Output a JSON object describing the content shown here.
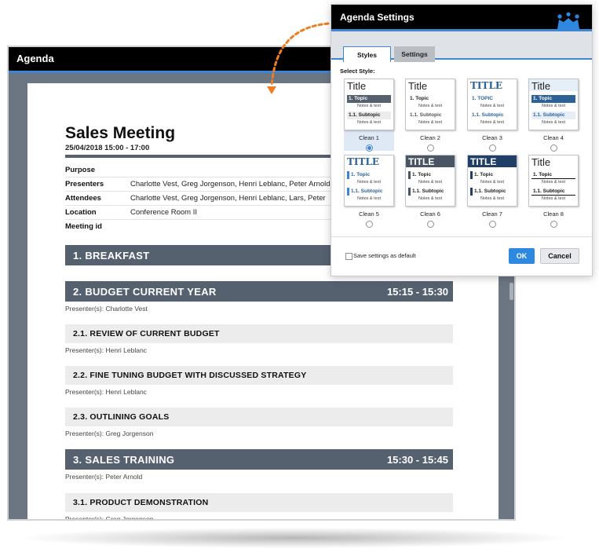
{
  "agenda": {
    "title": "Agenda",
    "meeting_title": "Sales Meeting",
    "meeting_date": "25/04/2018 15:00 - 17:00",
    "info": [
      {
        "label": "Purpose",
        "value": ""
      },
      {
        "label": "Presenters",
        "value": "Charlotte Vest, Greg Jorgenson, Henri Leblanc, Peter Arnold"
      },
      {
        "label": "Attendees",
        "value": "Charlotte Vest, Greg Jorgenson, Henri Leblanc, Lars, Peter"
      },
      {
        "label": "Location",
        "value": "Conference Room II"
      },
      {
        "label": "Meeting id",
        "value": ""
      }
    ],
    "items": [
      {
        "kind": "section",
        "title": "1. BREAKFAST",
        "time": ""
      },
      {
        "kind": "section",
        "title": "2. BUDGET CURRENT YEAR",
        "time": "15:15 - 15:30",
        "presenter": "Presenter(s): Charlotte Vest"
      },
      {
        "kind": "sub",
        "title": "2.1. REVIEW OF CURRENT BUDGET",
        "presenter": "Presenter(s): Henri Leblanc"
      },
      {
        "kind": "sub",
        "title": "2.2. FINE TUNING BUDGET WITH DISCUSSED STRATEGY",
        "presenter": "Presenter(s): Henri Leblanc"
      },
      {
        "kind": "sub",
        "title": "2.3. OUTLINING GOALS",
        "presenter": "Presenter(s): Greg Jorgenson"
      },
      {
        "kind": "section",
        "title": "3. SALES TRAINING",
        "time": "15:30 - 15:45",
        "presenter": "Presenter(s): Peter Arnold"
      },
      {
        "kind": "sub",
        "title": "3.1. PRODUCT DEMONSTRATION",
        "presenter": "Presenter(s): Greg Jorgenson"
      }
    ]
  },
  "settings_dialog": {
    "title": "Agenda Settings",
    "logo_icon": "people-group-icon",
    "tabs": [
      {
        "label": "Styles",
        "active": true
      },
      {
        "label": "Settings",
        "active": false
      }
    ],
    "select_label": "Select Style:",
    "styles": [
      {
        "label": "Clean 1",
        "selected": true,
        "thumb": {
          "title": "Title",
          "topic": "1. Topic",
          "notes1": "Notes & text",
          "subtopic": "1.1. Subtopic",
          "notes2": "Notes & text"
        }
      },
      {
        "label": "Clean 2",
        "selected": false,
        "thumb": {
          "title": "Title",
          "topic": "1. Topic",
          "notes1": "Notes & text",
          "subtopic": "1.1. Subtopic",
          "notes2": "Notes & text"
        }
      },
      {
        "label": "Clean 3",
        "selected": false,
        "thumb": {
          "title": "TITLE",
          "topic": "1. TOPIC",
          "notes1": "Notes & text",
          "subtopic": "1.1. Subtopic",
          "notes2": "Notes & text"
        }
      },
      {
        "label": "Clean 4",
        "selected": false,
        "thumb": {
          "title": "Title",
          "topic": "1. Topic",
          "notes1": "Notes & text",
          "subtopic": "1.1. Subtopic",
          "notes2": "Notes & text"
        }
      },
      {
        "label": "Clean 5",
        "selected": false,
        "thumb": {
          "title": "TITLE",
          "topic": "1. Topic",
          "notes1": "Notes & text",
          "subtopic": "1.1. Subtopic",
          "notes2": "Notes & text"
        }
      },
      {
        "label": "Clean 6",
        "selected": false,
        "thumb": {
          "title": "TITLE",
          "topic": "1. Topic",
          "notes1": "Notes & text",
          "subtopic": "1.1. Subtopic",
          "notes2": "Notes & text"
        }
      },
      {
        "label": "Clean 7",
        "selected": false,
        "thumb": {
          "title": "TITLE",
          "topic": "1. Topic",
          "notes1": "Notes & text",
          "subtopic": "1.1. Subtopic",
          "notes2": "Notes & text"
        }
      },
      {
        "label": "Clean 8",
        "selected": false,
        "thumb": {
          "title": "Title",
          "topic": "1. Topic",
          "notes1": "Notes & text",
          "subtopic": "1.1. Subtopic",
          "notes2": "Notes & text"
        }
      }
    ],
    "save_default_label": "Save settings as default",
    "save_default_checked": false,
    "ok_label": "OK",
    "cancel_label": "Cancel"
  },
  "colors": {
    "accent_blue": "#3d86d6",
    "section_bar": "#566170",
    "titlebar": "#000000",
    "connector_orange": "#ef7d22"
  }
}
